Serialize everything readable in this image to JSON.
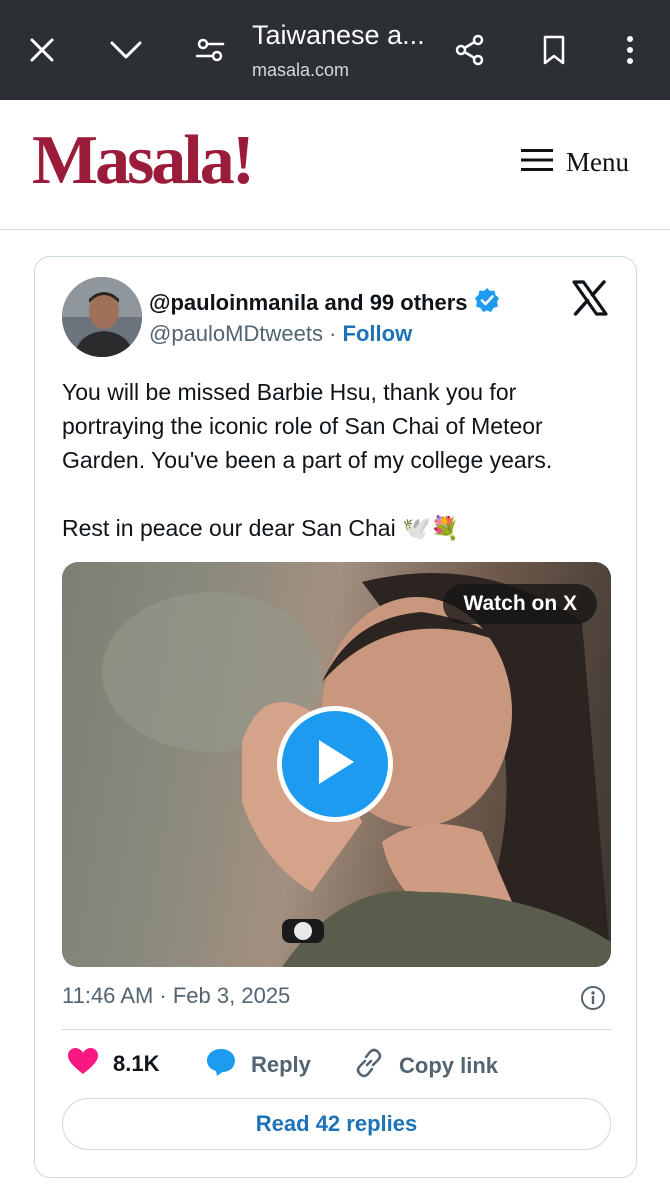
{
  "browser": {
    "tab_title": "Taiwanese a...",
    "url": "masala.com"
  },
  "site": {
    "logo": "Masala!",
    "menu_label": "Menu",
    "brand_color": "#9b1b3b"
  },
  "tweet": {
    "author": "@pauloinmanila and 99 others",
    "handle": "@pauloMDtweets",
    "separator": "·",
    "follow_label": "Follow",
    "text_p1": "You will be missed Barbie Hsu, thank you for portraying the iconic role of San Chai of Meteor Garden. You've been a part of my college years.",
    "text_p2": "Rest in peace our dear San Chai 🕊️💐",
    "media": {
      "watch_label": "Watch on X"
    },
    "timestamp": "11:46 AM · Feb 3, 2025",
    "likes": "8.1K",
    "reply_label": "Reply",
    "copy_link_label": "Copy link",
    "read_replies_label": "Read 42 replies",
    "accent_color": "#1d9bf0",
    "like_color": "#f91880"
  },
  "icons": [
    "close-icon",
    "chevron-down-icon",
    "page-settings-icon",
    "share-icon",
    "bookmark-icon",
    "more-vert-icon",
    "menu-icon",
    "x-logo-icon",
    "verified-badge-icon",
    "play-icon",
    "info-icon",
    "heart-icon",
    "reply-icon",
    "link-icon"
  ]
}
